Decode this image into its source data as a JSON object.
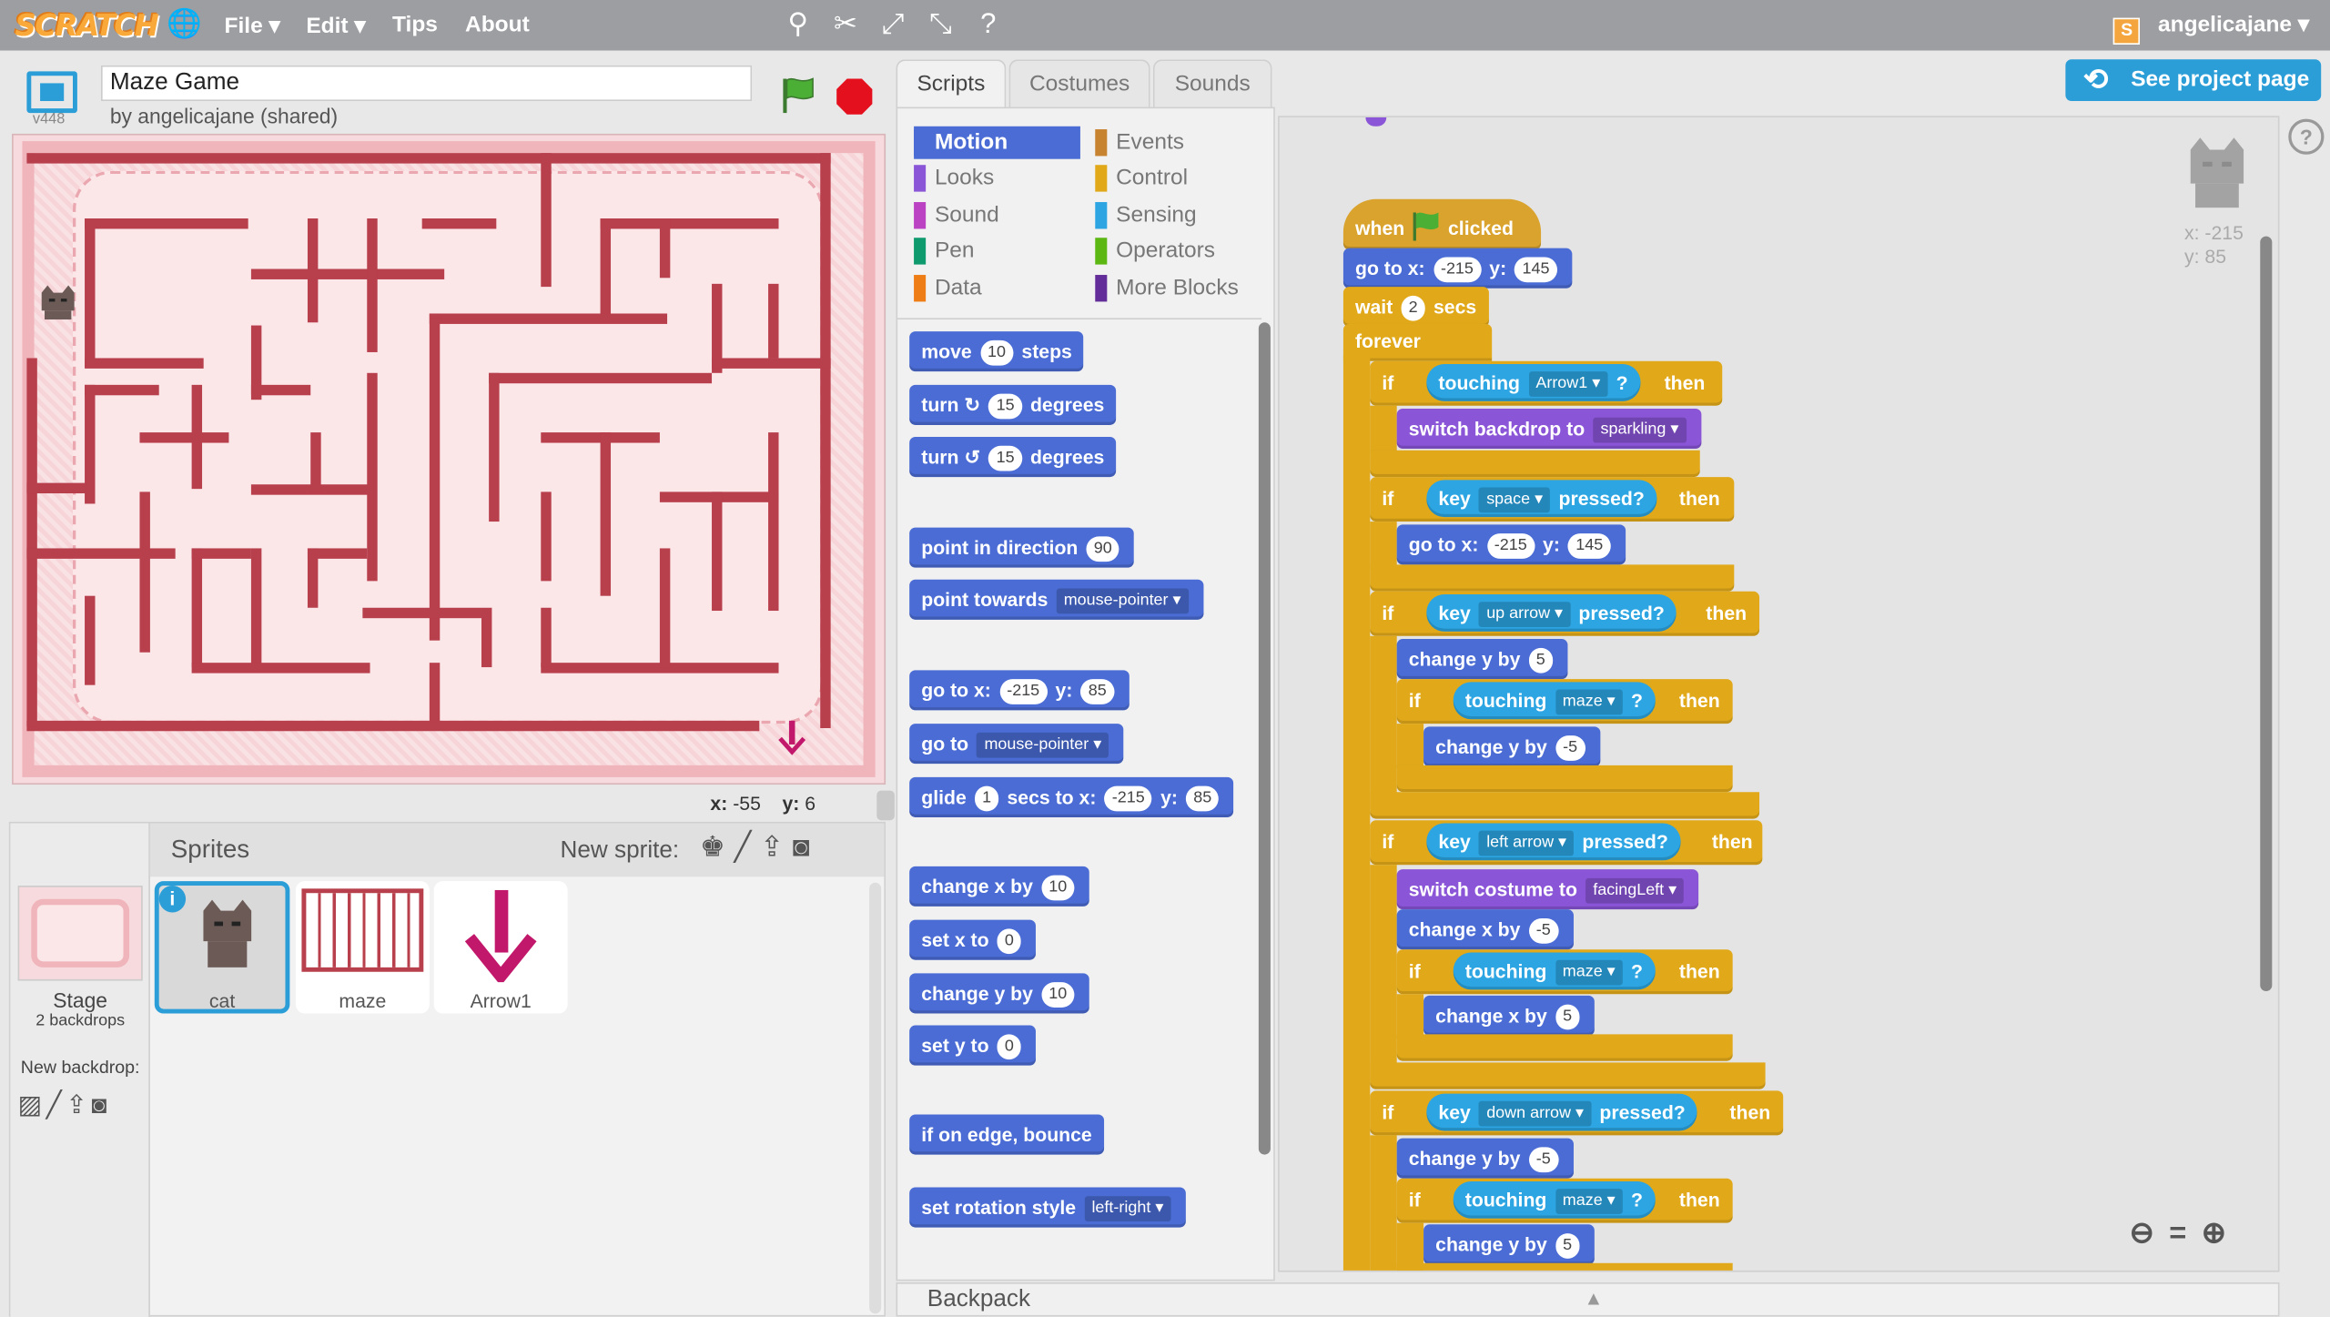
{
  "app": {
    "logo": "SCRATCH",
    "menu": [
      "File",
      "Edit",
      "Tips",
      "About"
    ],
    "user": "angelicajane",
    "see_project": "See project page"
  },
  "project": {
    "title": "Maze Game",
    "author": "by angelicajane (shared)",
    "version": "v448"
  },
  "stage": {
    "coords_x_label": "x:",
    "coords_x": "-55",
    "coords_y_label": "y:",
    "coords_y": "6"
  },
  "sprites_panel": {
    "header": "Sprites",
    "new_sprite": "New sprite:",
    "stage_label": "Stage",
    "stage_sub": "2 backdrops",
    "new_backdrop": "New backdrop:",
    "sprites": [
      {
        "name": "cat"
      },
      {
        "name": "maze"
      },
      {
        "name": "Arrow1"
      }
    ]
  },
  "tabs": [
    "Scripts",
    "Costumes",
    "Sounds"
  ],
  "categories": [
    {
      "label": "Motion",
      "color": "#4a6cd4"
    },
    {
      "label": "Events",
      "color": "#c88330"
    },
    {
      "label": "Looks",
      "color": "#8a55d7"
    },
    {
      "label": "Control",
      "color": "#e1a91a"
    },
    {
      "label": "Sound",
      "color": "#bb42c3"
    },
    {
      "label": "Sensing",
      "color": "#2ca5e2"
    },
    {
      "label": "Pen",
      "color": "#0e9a6c"
    },
    {
      "label": "Operators",
      "color": "#5cb712"
    },
    {
      "label": "Data",
      "color": "#ee7d16"
    },
    {
      "label": "More Blocks",
      "color": "#632d99"
    }
  ],
  "palette": {
    "move": [
      "move",
      "10",
      "steps"
    ],
    "turn_right": [
      "turn",
      "15",
      "degrees"
    ],
    "turn_left": [
      "turn",
      "15",
      "degrees"
    ],
    "point_dir": [
      "point in direction",
      "90"
    ],
    "point_towards": [
      "point towards",
      "mouse-pointer"
    ],
    "goto_xy": [
      "go to x:",
      "-215",
      "y:",
      "85"
    ],
    "goto": [
      "go to",
      "mouse-pointer"
    ],
    "glide": [
      "glide",
      "1",
      "secs to x:",
      "-215",
      "y:",
      "85"
    ],
    "change_x": [
      "change x by",
      "10"
    ],
    "set_x": [
      "set x to",
      "0"
    ],
    "change_y": [
      "change y by",
      "10"
    ],
    "set_y": [
      "set y to",
      "0"
    ],
    "bounce": "if on edge, bounce",
    "rotation": [
      "set rotation style",
      "left-right"
    ]
  },
  "script": {
    "hat": [
      "when",
      "clicked"
    ],
    "goto": [
      "go to x:",
      "-215",
      "y:",
      "145"
    ],
    "wait": [
      "wait",
      "2",
      "secs"
    ],
    "forever": "forever",
    "if1": [
      "if",
      "touching",
      "Arrow1",
      "?",
      "then"
    ],
    "backdrop": [
      "switch backdrop to",
      "sparkling"
    ],
    "if2": [
      "if",
      "key",
      "space",
      "pressed?",
      "then"
    ],
    "goto2": [
      "go to x:",
      "-215",
      "y:",
      "145"
    ],
    "if3": [
      "if",
      "key",
      "up arrow",
      "pressed?",
      "then"
    ],
    "cy1": [
      "change y by",
      "5"
    ],
    "if3b": [
      "if",
      "touching",
      "maze",
      "?",
      "then"
    ],
    "cy2": [
      "change y by",
      "-5"
    ],
    "if4": [
      "if",
      "key",
      "left arrow",
      "pressed?",
      "then"
    ],
    "costume": [
      "switch costume to",
      "facingLeft"
    ],
    "cx1": [
      "change x by",
      "-5"
    ],
    "if4b": [
      "if",
      "touching",
      "maze",
      "?",
      "then"
    ],
    "cx2": [
      "change x by",
      "5"
    ],
    "if5": [
      "if",
      "key",
      "down arrow",
      "pressed?",
      "then"
    ],
    "cy3": [
      "change y by",
      "-5"
    ],
    "if5b": [
      "if",
      "touching",
      "maze",
      "?",
      "then"
    ],
    "cy4": [
      "change y by",
      "5"
    ]
  },
  "sprite_info": {
    "x": "x: -215",
    "y": "y: 85"
  },
  "backpack": "Backpack"
}
